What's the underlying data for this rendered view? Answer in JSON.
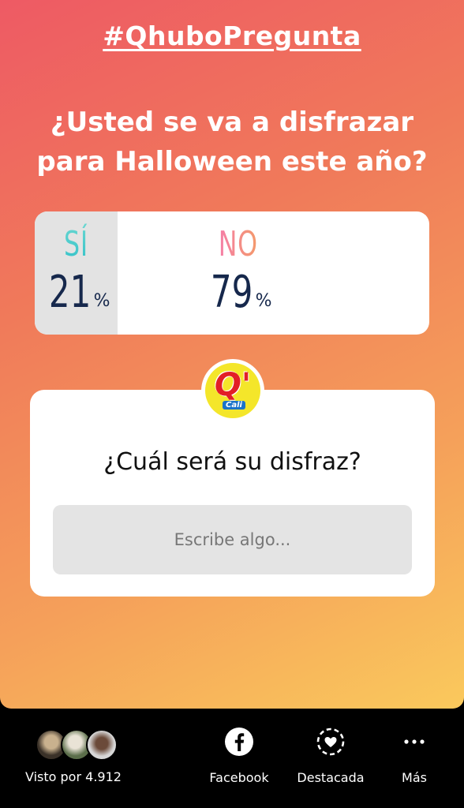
{
  "story": {
    "hashtag": "#QhuboPregunta",
    "question_line1": "¿Usted se va a disfrazar",
    "question_line2": "para Halloween este año?"
  },
  "poll": {
    "options": [
      {
        "label": "SÍ",
        "percent": 21,
        "percent_text": "21",
        "percent_symbol": "%"
      },
      {
        "label": "NO",
        "percent": 79,
        "percent_text": "79",
        "percent_symbol": "%"
      }
    ]
  },
  "question_sticker": {
    "question": "¿Cuál será su disfraz?",
    "placeholder": "Escribe algo..."
  },
  "logo": {
    "mark": "Q'",
    "city": "Cali"
  },
  "footer": {
    "seen_by": "Visto por 4.912",
    "facebook": "Facebook",
    "highlight": "Destacada",
    "more": "Más"
  },
  "colors": {
    "gradient_start": "#ee5a64",
    "gradient_end": "#fac95c",
    "poll_percent": "#16284c",
    "si_color": "#2ec0c8",
    "no_color": "#f58a8a"
  }
}
